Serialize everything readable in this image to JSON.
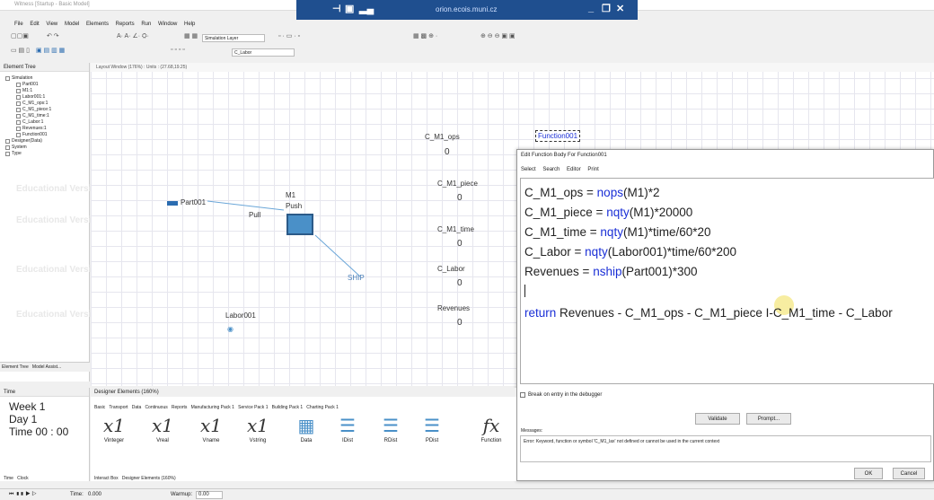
{
  "window": {
    "title": "Witness [Startup - Basic Model]",
    "remote_host": "orion.ecois.muni.cz"
  },
  "menu": [
    "File",
    "Edit",
    "View",
    "Model",
    "Elements",
    "Reports",
    "Run",
    "Window",
    "Help"
  ],
  "toolbar": {
    "layer_combo": "Simulation Layer",
    "element_combo": "C_Labor"
  },
  "tree": {
    "header": "Element Tree",
    "items": [
      "Simulation",
      "Part001",
      "M1:1",
      "Labor001:1",
      "C_M1_ops:1",
      "C_M1_piece:1",
      "C_M1_time:1",
      "C_Labor:1",
      "Revenues:1",
      "Function001",
      "Designer(Data)",
      "System",
      "Type"
    ],
    "tabs": [
      "Element Tree",
      "Model Assist..."
    ],
    "watermark": "Educational Version"
  },
  "layout": {
    "header": "Layout Window (176%) : Units : (27.68,19.25)",
    "part": "Part001",
    "machine": "M1",
    "push": "Push",
    "pull": "Pull",
    "ship": "SHIP",
    "labor": "Labor001",
    "function_box": "Function001",
    "counters": [
      {
        "label": "C_M1_ops",
        "value": "0"
      },
      {
        "label": "C_M1_piece",
        "value": "0"
      },
      {
        "label": "C_M1_time",
        "value": "0"
      },
      {
        "label": "C_Labor",
        "value": "0"
      },
      {
        "label": "Revenues",
        "value": "0"
      }
    ]
  },
  "dialog": {
    "title": "Edit Function Body For Function001",
    "menu": [
      "Select",
      "Search",
      "Editor",
      "Print"
    ],
    "code": [
      {
        "pre": "C_M1_ops = ",
        "kw": "nops",
        "post": "(M1)*2"
      },
      {
        "pre": "C_M1_piece = ",
        "kw": "nqty",
        "post": "(M1)*20000"
      },
      {
        "pre": "C_M1_time = ",
        "kw": "nqty",
        "post": "(M1)*time/60*20"
      },
      {
        "pre": "C_Labor = ",
        "kw": "nqty",
        "post": "(Labor001)*time/60*200"
      },
      {
        "pre": "Revenues = ",
        "kw": "nship",
        "post": "(Part001)*300"
      }
    ],
    "return_kw": "return",
    "return_expr": " Revenues - C_M1_ops - C_M1_piece I-C_M1_time - C_Labor",
    "debugger_label": "Break on entry in the debugger",
    "validate": "Validate",
    "prompt": "Prompt...",
    "messages_label": "Messages:",
    "message": "Error: Keyword, function or symbol 'C_M1_lax' not defined or cannot be used in the current context",
    "ok": "OK",
    "cancel": "Cancel"
  },
  "time": {
    "header": "Time",
    "week": "Week 1",
    "day": "Day  1",
    "time": "Time 00 : 00",
    "tabs": [
      "Time",
      "Clock"
    ]
  },
  "designer": {
    "header": "Designer Elements (160%)",
    "tabs": [
      "Basic",
      "Transport",
      "Data",
      "Continuous",
      "Reports",
      "Manufacturing Pack 1",
      "Service Pack 1",
      "Building Pack 1",
      "Charting Pack 1"
    ],
    "icons": [
      "Vinteger",
      "Vreal",
      "Vname",
      "Vstring",
      "Data",
      "IDist",
      "RDist",
      "PDist",
      "Function"
    ],
    "bottom_tabs": [
      "Interact Box",
      "Designer Elements (160%)"
    ]
  },
  "status": {
    "time_label": "Time:",
    "time_value": "0.000",
    "warmup_label": "Warmup:",
    "warmup_value": "0.00"
  },
  "colors": {
    "remote_bar": "#1f4f8f",
    "keyword": "#1a2fd6",
    "machine": "#4a90c8",
    "part_bar": "#2b6cb0",
    "ship_line": "#6aa6d8"
  }
}
